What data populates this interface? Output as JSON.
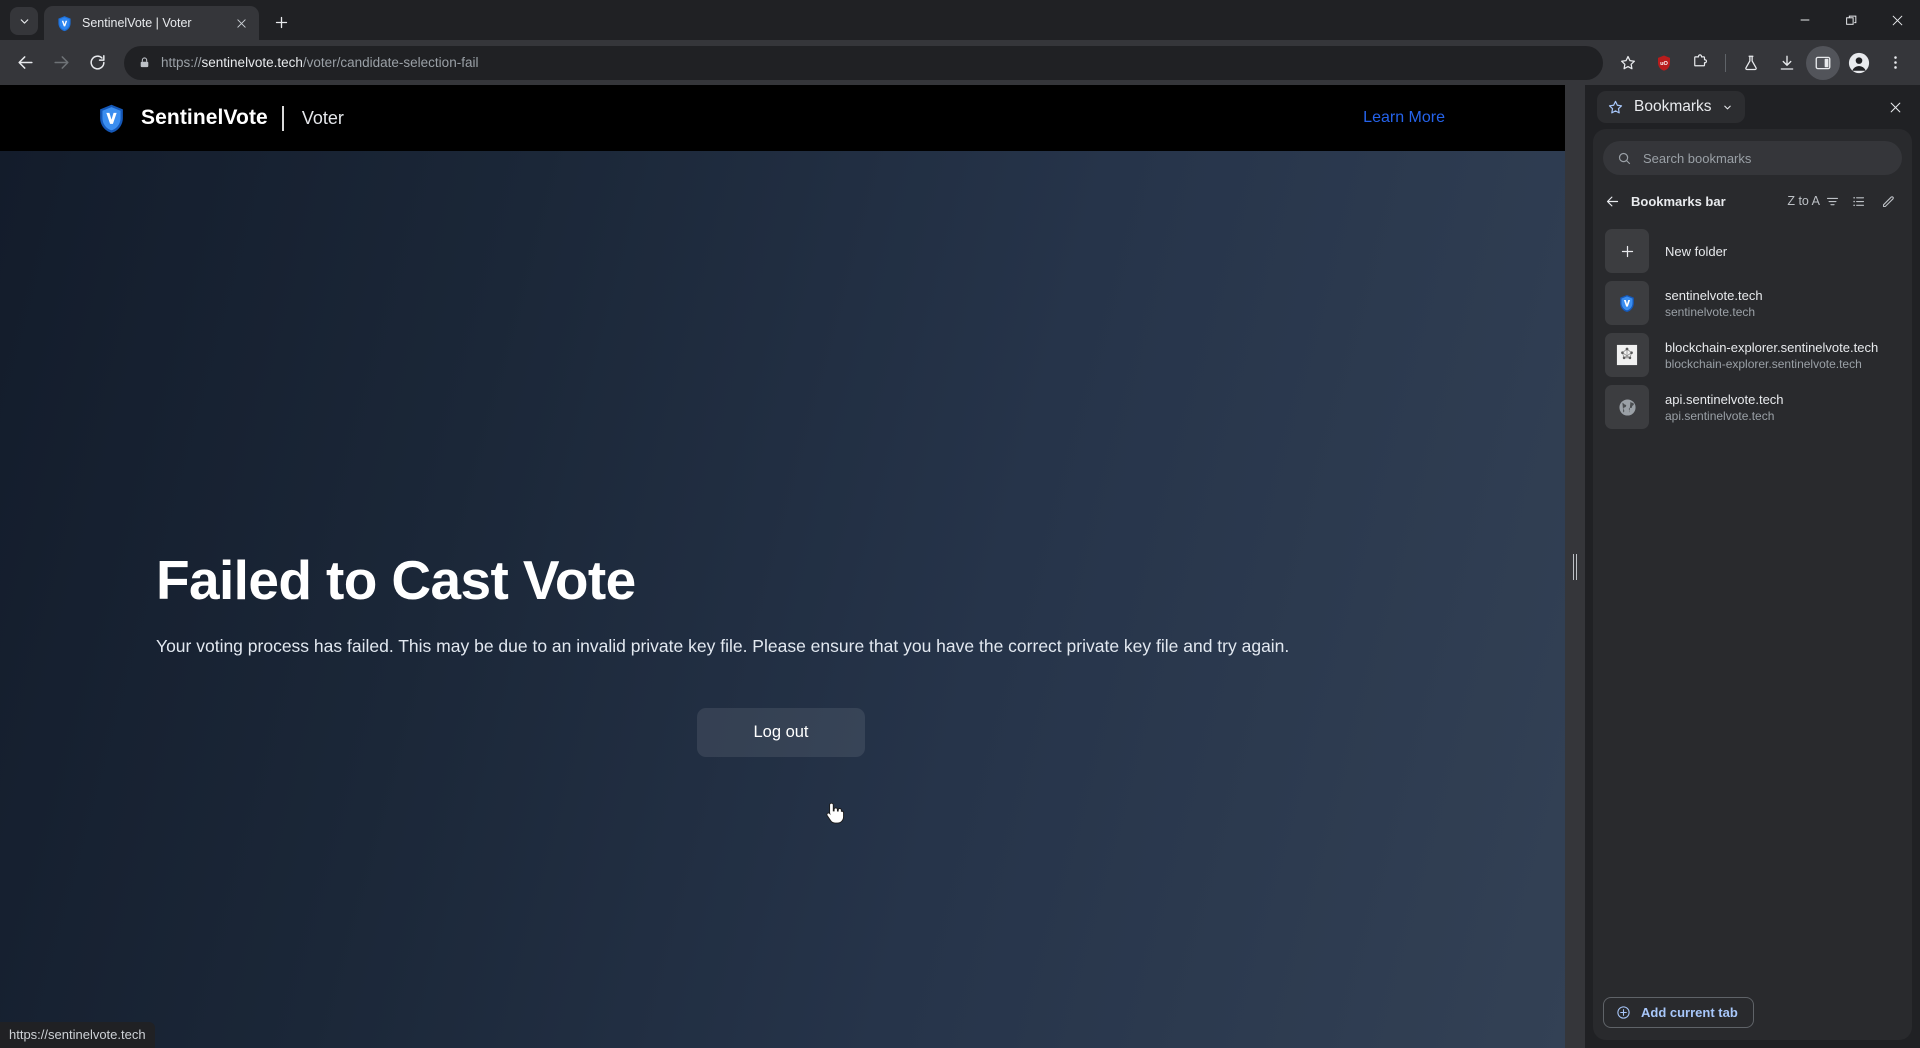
{
  "browser": {
    "tab": {
      "title": "SentinelVote | Voter",
      "favicon": "sentinelvote-shield-icon"
    },
    "tab_search_icon": "chevron-down-icon",
    "new_tab_icon": "plus-icon",
    "window_controls": [
      "minimize-icon",
      "restore-icon",
      "close-icon"
    ],
    "nav": {
      "back_icon": "arrow-left-icon",
      "forward_icon": "arrow-right-icon",
      "reload_icon": "reload-icon"
    },
    "omnibox": {
      "lock_icon": "lock-icon",
      "scheme": "https://",
      "domain": "sentinelvote.tech",
      "path": "/voter/candidate-selection-fail"
    },
    "toolbar_icons": [
      "bookmark-star-icon",
      "ublock-origin-icon",
      "extensions-puzzle-icon",
      "experiments-flask-icon",
      "downloads-icon",
      "side-panel-icon",
      "profile-avatar-icon",
      "more-menu-icon"
    ],
    "status_bar_url": "https://sentinelvote.tech"
  },
  "page": {
    "header": {
      "logo_icon": "sentinelvote-shield-icon",
      "brand": "SentinelVote",
      "role": "Voter",
      "learn_more": "Learn More"
    },
    "hero": {
      "title": "Failed to Cast Vote",
      "description": "Your voting process has failed. This may be due to an invalid private key file. Please ensure that you have the correct private key file and try again.",
      "logout_label": "Log out"
    }
  },
  "side_panel": {
    "header": {
      "star_icon": "bookmark-star-icon",
      "title": "Bookmarks",
      "dropdown_icon": "chevron-down-icon",
      "close_icon": "close-icon"
    },
    "search": {
      "icon": "search-icon",
      "placeholder": "Search bookmarks"
    },
    "bar": {
      "back_icon": "arrow-left-icon",
      "title": "Bookmarks bar",
      "sort_label": "Z to A",
      "sort_icon": "sort-icon",
      "list_icon": "list-view-icon",
      "edit_icon": "edit-pencil-icon"
    },
    "new_folder": {
      "icon": "plus-icon",
      "label": "New folder"
    },
    "items": [
      {
        "name": "sentinelvote.tech",
        "url": "sentinelvote.tech",
        "favicon": "sentinelvote-shield-icon"
      },
      {
        "name": "blockchain-explorer.sentinelvote.tech",
        "url": "blockchain-explorer.sentinelvote.tech",
        "favicon": "blockchain-network-icon"
      },
      {
        "name": "api.sentinelvote.tech",
        "url": "api.sentinelvote.tech",
        "favicon": "globe-icon"
      }
    ],
    "footer": {
      "icon": "plus-circle-icon",
      "label": "Add current tab"
    }
  },
  "colors": {
    "accent_blue": "#2563eb",
    "link_blue": "#a8c7fa",
    "chrome_bg": "#202124",
    "toolbar_bg": "#35363a",
    "page_dark": "#131c2b",
    "page_light": "#334155"
  }
}
